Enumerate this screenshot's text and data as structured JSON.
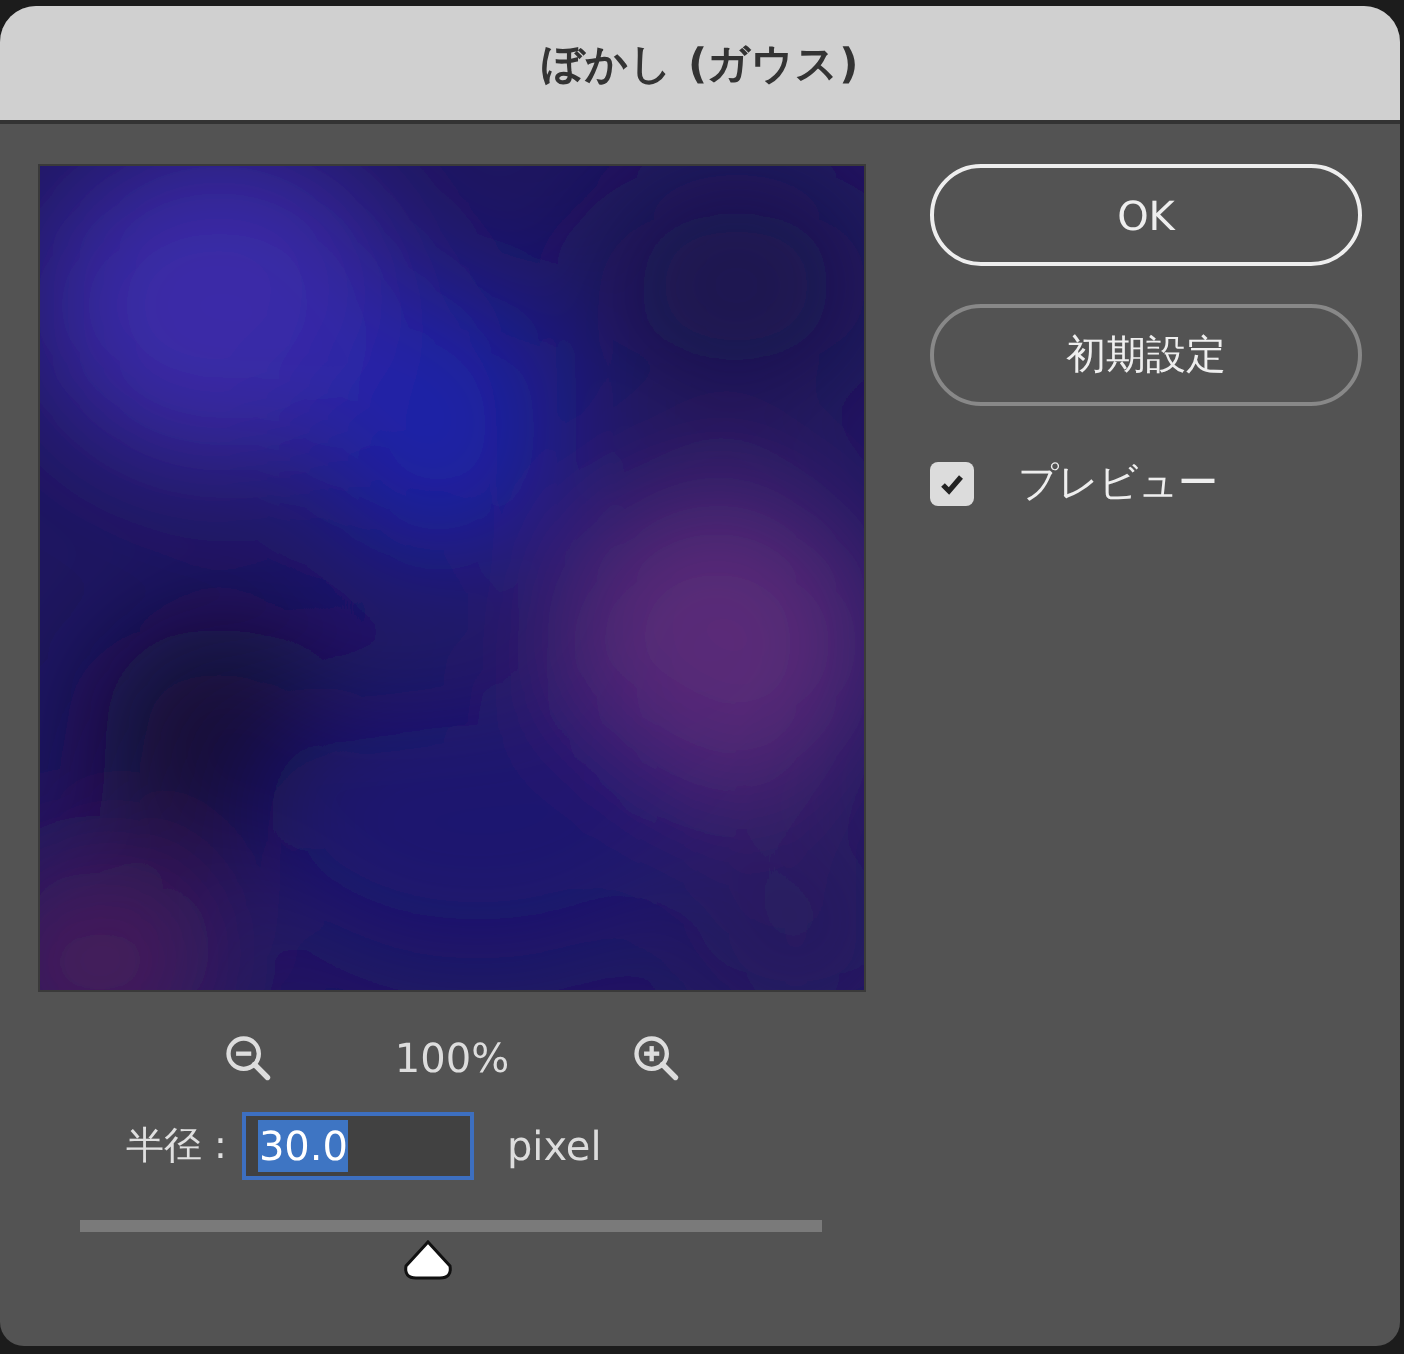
{
  "window": {
    "title": "ぼかし (ガウス)"
  },
  "zoom": {
    "level_text": "100%"
  },
  "radius": {
    "label": "半径 :",
    "value": "30.0",
    "value_selected": true,
    "unit": "pixel"
  },
  "slider": {
    "level": 0.47
  },
  "buttons": [
    {
      "label": "OK",
      "primary": true
    },
    {
      "label": "初期設定",
      "primary": false
    }
  ],
  "preview_toggle": {
    "label": "プレビュー",
    "checked": true
  }
}
